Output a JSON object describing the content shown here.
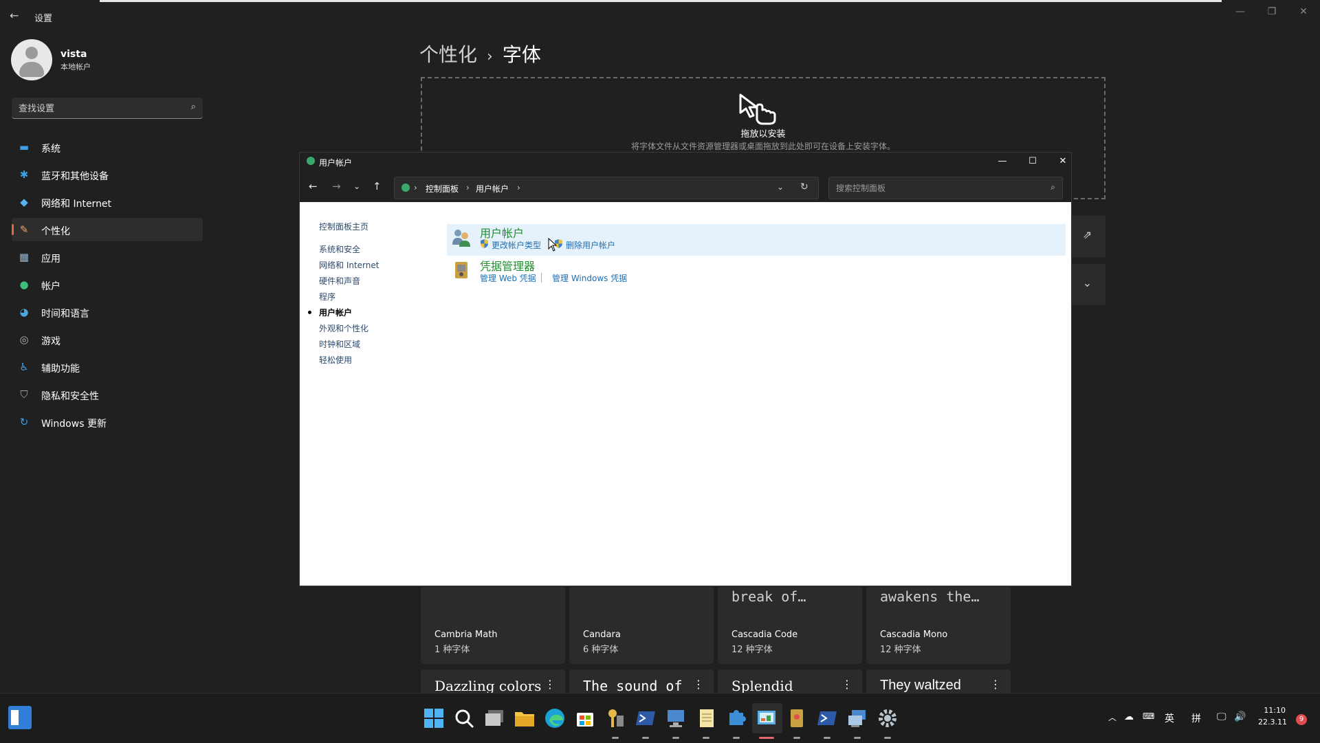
{
  "window": {
    "app_title": "设置",
    "controls": {
      "minimize": "—",
      "restore": "❐",
      "close": "✕"
    }
  },
  "profile": {
    "name": "vista",
    "account_type": "本地帐户"
  },
  "search": {
    "placeholder": "查找设置"
  },
  "nav": [
    {
      "label": "系统",
      "icon": "display-icon"
    },
    {
      "label": "蓝牙和其他设备",
      "icon": "bluetooth-icon"
    },
    {
      "label": "网络和 Internet",
      "icon": "wifi-icon"
    },
    {
      "label": "个性化",
      "icon": "brush-icon",
      "active": true
    },
    {
      "label": "应用",
      "icon": "apps-icon"
    },
    {
      "label": "帐户",
      "icon": "person-icon"
    },
    {
      "label": "时间和语言",
      "icon": "globe-clock-icon"
    },
    {
      "label": "游戏",
      "icon": "gamepad-icon"
    },
    {
      "label": "辅助功能",
      "icon": "accessibility-icon"
    },
    {
      "label": "隐私和安全性",
      "icon": "shield-icon"
    },
    {
      "label": "Windows 更新",
      "icon": "update-icon"
    }
  ],
  "main": {
    "breadcrumb_parent": "个性化",
    "breadcrumb_sep": "›",
    "breadcrumb_current": "字体",
    "drop_title": "拖放以安装",
    "drop_subtitle": "将字体文件从文件资源管理器或桌面拖放到此处即可在设备上安装字体。",
    "fonts": [
      {
        "sample": "",
        "name": "Cambria Math",
        "count": "1 种字体"
      },
      {
        "sample": "",
        "name": "Candara",
        "count": "6 种字体"
      },
      {
        "sample": "break of…",
        "name": "Cascadia Code",
        "count": "12 种字体"
      },
      {
        "sample": "awakens the…",
        "name": "Cascadia Mono",
        "count": "12 种字体"
      }
    ],
    "fonts_row2": [
      {
        "sample": "Dazzling colors"
      },
      {
        "sample": "The sound of"
      },
      {
        "sample": "Splendid"
      },
      {
        "sample": "They waltzed"
      }
    ]
  },
  "control_panel": {
    "title": "用户帐户",
    "address": [
      "控制面板",
      "用户帐户"
    ],
    "search_placeholder": "搜索控制面板",
    "left_links": [
      {
        "label": "控制面板主页"
      },
      {
        "label": "系统和安全"
      },
      {
        "label": "网络和 Internet"
      },
      {
        "label": "硬件和声音"
      },
      {
        "label": "程序"
      },
      {
        "label": "用户帐户",
        "current": true
      },
      {
        "label": "外观和个性化"
      },
      {
        "label": "时钟和区域"
      },
      {
        "label": "轻松使用"
      }
    ],
    "categories": [
      {
        "title": "用户帐户",
        "tasks": [
          "更改帐户类型",
          "删除用户帐户"
        ]
      },
      {
        "title": "凭据管理器",
        "tasks": [
          "管理 Web 凭据",
          "管理 Windows 凭据"
        ]
      }
    ]
  },
  "taskbar": {
    "tray": {
      "ime_lang": "英",
      "ime_mode": "拼"
    },
    "clock": {
      "time": "11:10",
      "date": "22.3.11"
    },
    "notification_count": "9"
  }
}
